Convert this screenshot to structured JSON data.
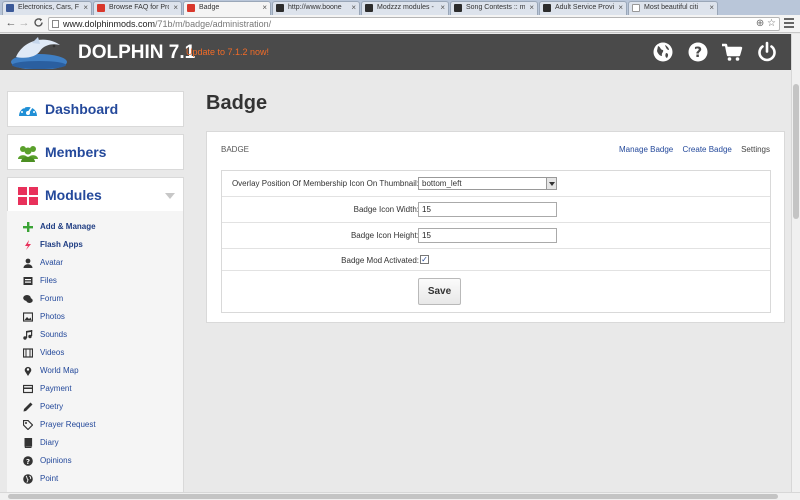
{
  "browser": {
    "tabs": [
      {
        "label": "Electronics, Cars, Fa",
        "favicon_color": "#3b5998"
      },
      {
        "label": "Browse FAQ for Pro",
        "favicon_color": "#d9372b"
      },
      {
        "label": "Badge",
        "favicon_color": "#d9372b"
      },
      {
        "label": "http://www.boone",
        "favicon_color": "#2c2c2c"
      },
      {
        "label": "Modzzz modules -",
        "favicon_color": "#2c2c2c"
      },
      {
        "label": "Song Contests :: m",
        "favicon_color": "#2c2c2c"
      },
      {
        "label": "Adult Service Provi",
        "favicon_color": "#2c2c2c"
      },
      {
        "label": "Most beautiful citi",
        "favicon_color": "#ffffff"
      }
    ],
    "url_host": "www.dolphinmods.com",
    "url_path": "/71b/m/badge/administration/",
    "close_glyph": "×",
    "back_glyph": "←",
    "forward_glyph": "→",
    "reload_glyph": "C",
    "zoom_glyph": "⊕",
    "star_glyph": "☆"
  },
  "header": {
    "title": "DOLPHIN 7.1",
    "update_text": "Update to 7.1.2 now!",
    "icons": [
      "globe-icon",
      "help-icon",
      "cart-icon",
      "power-icon"
    ]
  },
  "sidebar": {
    "dashboard": "Dashboard",
    "members": "Members",
    "modules": "Modules",
    "module_items": [
      {
        "label": "Add & Manage",
        "icon": "plus-icon",
        "bold": true
      },
      {
        "label": "Flash Apps",
        "icon": "bolt-icon",
        "bold": true
      },
      {
        "label": "Avatar",
        "icon": "user-icon"
      },
      {
        "label": "Files",
        "icon": "folder-icon"
      },
      {
        "label": "Forum",
        "icon": "comments-icon"
      },
      {
        "label": "Photos",
        "icon": "picture-icon"
      },
      {
        "label": "Sounds",
        "icon": "music-icon"
      },
      {
        "label": "Videos",
        "icon": "film-icon"
      },
      {
        "label": "World Map",
        "icon": "map-marker-icon"
      },
      {
        "label": "Payment",
        "icon": "credit-card-icon"
      },
      {
        "label": "Poetry",
        "icon": "pencil-icon"
      },
      {
        "label": "Prayer Request",
        "icon": "tag-icon"
      },
      {
        "label": "Diary",
        "icon": "book-icon"
      },
      {
        "label": "Opinions",
        "icon": "question-icon"
      },
      {
        "label": "Point",
        "icon": "globe-icon"
      }
    ]
  },
  "main": {
    "title": "Badge",
    "panel_title": "BADGE",
    "links": {
      "manage": "Manage Badge",
      "create": "Create Badge",
      "settings": "Settings"
    },
    "fields": {
      "position_label": "Overlay Position Of Membership Icon On Thumbnail:",
      "position_value": "bottom_left",
      "width_label": "Badge Icon Width:",
      "width_value": "15",
      "height_label": "Badge Icon Height:",
      "height_value": "15",
      "activated_label": "Badge Mod Activated:",
      "activated_checked": true,
      "check_glyph": "✓"
    },
    "save_label": "Save"
  },
  "colors": {
    "accent": "#24499b",
    "header_bg": "#4a4a4a",
    "update_orange": "#f26b27",
    "members_green": "#5aa02c",
    "modules_pink": "#e8315b"
  }
}
